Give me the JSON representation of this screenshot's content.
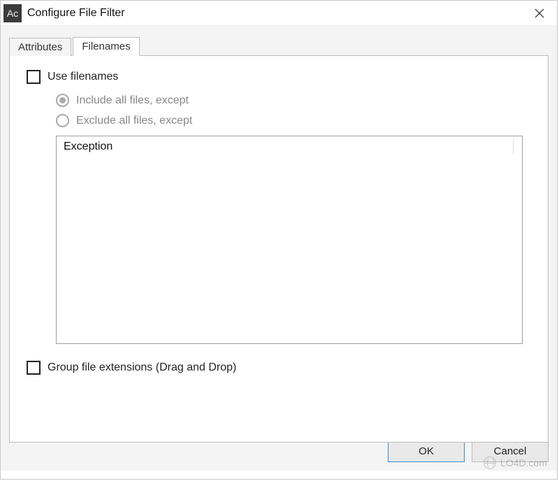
{
  "window": {
    "title": "Configure File Filter",
    "icon_text": "Ac"
  },
  "tabs": {
    "attributes": "Attributes",
    "filenames": "Filenames"
  },
  "panel": {
    "use_filenames": "Use filenames",
    "include_label": "Include all files, except",
    "exclude_label": "Exclude all files, except",
    "list_header": "Exception",
    "group_extensions": "Group file extensions (Drag and Drop)"
  },
  "buttons": {
    "ok": "OK",
    "cancel": "Cancel"
  },
  "watermark": "LO4D.com"
}
